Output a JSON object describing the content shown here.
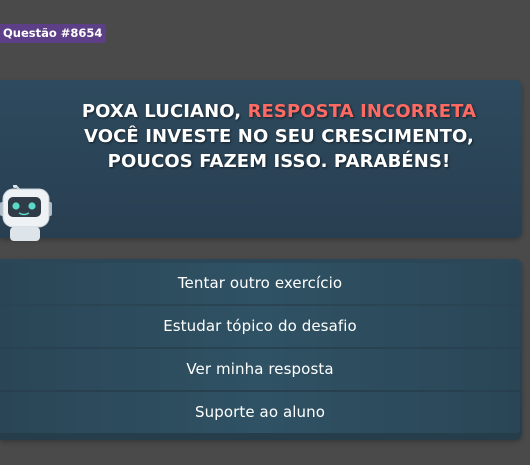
{
  "badge": {
    "question_label": "Questão #8654"
  },
  "result": {
    "line1_prefix": "POXA LUCIANO, ",
    "line1_highlight": "RESPOSTA INCORRETA",
    "message": "VOCÊ INVESTE NO SEU CRESCIMENTO, POUCOS FAZEM ISSO. PARABÉNS!",
    "highlight_color": "#ff6b63"
  },
  "mascot": {
    "icon": "robot-mascot-icon"
  },
  "actions": [
    {
      "label": "Tentar outro exercício"
    },
    {
      "label": "Estudar tópico do desafio"
    },
    {
      "label": "Ver minha resposta"
    },
    {
      "label": "Suporte ao aluno"
    }
  ]
}
